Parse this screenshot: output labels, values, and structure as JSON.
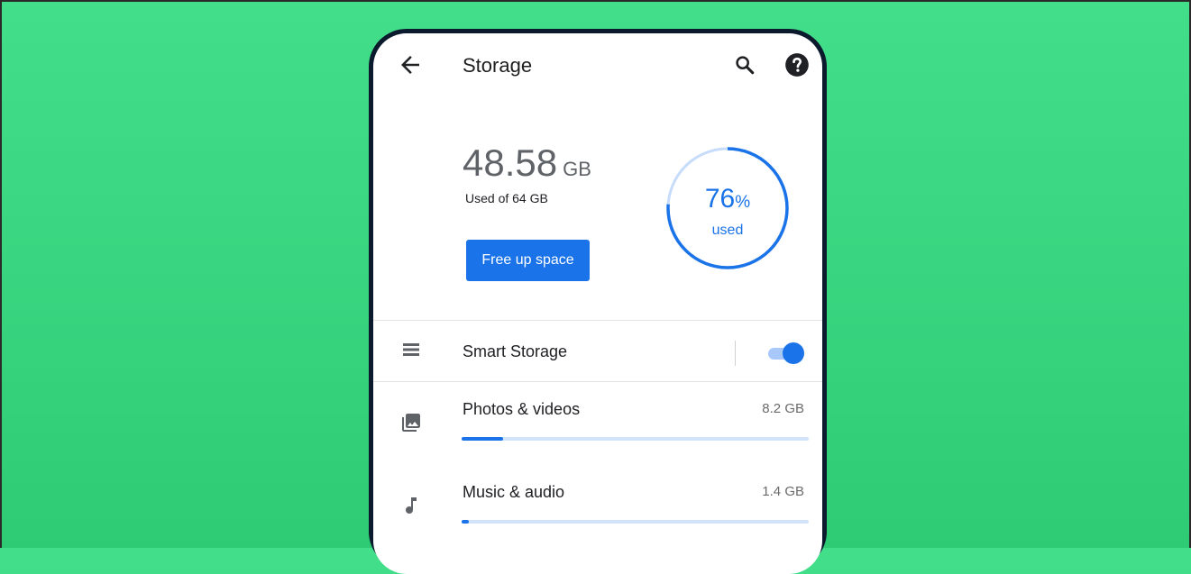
{
  "appbar": {
    "title": "Storage",
    "back_icon": "arrow-back-icon",
    "search_icon": "search-icon",
    "help_icon": "help-icon"
  },
  "summary": {
    "used_value": "48.58",
    "used_unit": "GB",
    "caption": "Used of 64 GB",
    "free_button_label": "Free up space",
    "percent_value": "76",
    "percent_symbol": "%",
    "percent_label": "used",
    "percent_fraction": 0.76
  },
  "smart_storage": {
    "label": "Smart Storage",
    "icon": "list-icon",
    "enabled": true
  },
  "categories": [
    {
      "label": "Photos & videos",
      "size": "8.2 GB",
      "icon": "photo-library-icon",
      "fraction": 0.12
    },
    {
      "label": "Music & audio",
      "size": "1.4 GB",
      "icon": "music-note-icon",
      "fraction": 0.02
    }
  ],
  "colors": {
    "accent": "#1a73e8",
    "accent_light": "#d2e3fc",
    "background_green": "#3ad884",
    "phone_frame": "#0c1a2e"
  }
}
